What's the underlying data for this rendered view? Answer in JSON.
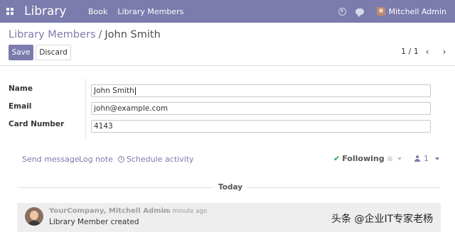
{
  "navbar": {
    "brand": "Library",
    "menu": [
      "Book",
      "Library Members"
    ],
    "user_name": "Mitchell Admin"
  },
  "breadcrumb": {
    "parent": "Library Members",
    "separator": "/",
    "current": "John Smith"
  },
  "buttons": {
    "save": "Save",
    "discard": "Discard"
  },
  "pager": {
    "value": "1 / 1",
    "prev_icon": "chevron-left-icon",
    "next_icon": "chevron-right-icon"
  },
  "form": {
    "fields": [
      {
        "label": "Name",
        "value": "John Smith"
      },
      {
        "label": "Email",
        "value": "john@example.com"
      },
      {
        "label": "Card Number",
        "value": "4143"
      }
    ]
  },
  "chatter": {
    "send_message": "Send message",
    "log_note": "Log note",
    "schedule_activity": "Schedule activity",
    "following": "Following",
    "followers_count": "1",
    "date_separator": "Today",
    "message": {
      "author": "YourCompany, Mitchell Admin",
      "date": "- a minute ago",
      "body": "Library Member created"
    }
  },
  "watermark": "头条 @企业IT专家老杨",
  "colors": {
    "navbar": "#7c7bad",
    "primary": "#7c7bad",
    "following_check": "#28a745"
  }
}
